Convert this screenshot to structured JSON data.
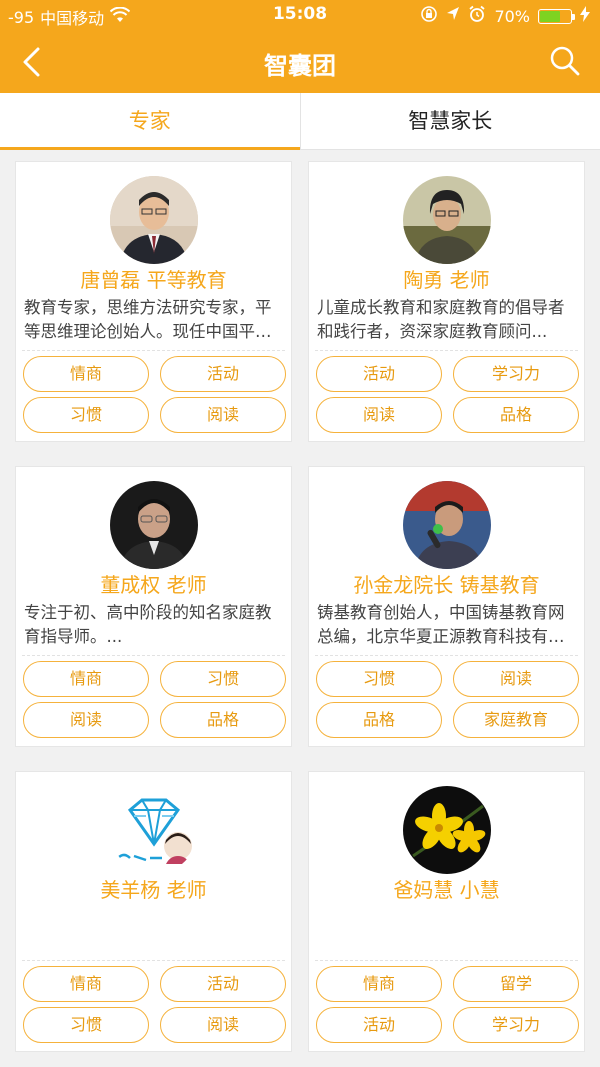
{
  "status_bar": {
    "signal": "-95",
    "carrier": "中国移动",
    "time": "15:08",
    "battery_text": "70%",
    "battery_level": 0.7,
    "icons": [
      "wifi-icon",
      "rotation-lock-icon",
      "location-icon",
      "alarm-icon",
      "battery-icon",
      "charging-icon"
    ]
  },
  "nav": {
    "title": "智囊团",
    "back_icon": "back-icon",
    "search_icon": "search-icon"
  },
  "tabs": [
    {
      "label": "专家",
      "active": true
    },
    {
      "label": "智慧家长",
      "active": false
    }
  ],
  "experts": [
    {
      "name": "唐曾磊 平等教育",
      "desc": "教育专家，思维方法研究专家，平等思维理论创始人。现任中国平等教育网总编...",
      "avatar": "man-in-suit-avatar",
      "tags": [
        "情商",
        "活动",
        "习惯",
        "阅读"
      ]
    },
    {
      "name": "陶勇 老师",
      "desc": "儿童成长教育和家庭教育的倡导者和践行者，资深家庭教育顾问...",
      "avatar": "man-outdoors-avatar",
      "tags": [
        "活动",
        "学习力",
        "阅读",
        "品格"
      ]
    },
    {
      "name": "董成权 老师",
      "desc": "专注于初、高中阶段的知名家庭教育指导师。...",
      "avatar": "man-glasses-avatar",
      "tags": [
        "情商",
        "习惯",
        "阅读",
        "品格"
      ]
    },
    {
      "name": "孙金龙院长 铸基教育",
      "desc": "铸基教育创始人，中国铸基教育网总编，北京华夏正源教育科技有限公司...",
      "avatar": "speaker-microphone-avatar",
      "tags": [
        "习惯",
        "阅读",
        "品格",
        "家庭教育"
      ]
    },
    {
      "name": "美羊杨 老师",
      "desc": "",
      "avatar": "diamond-logo-avatar",
      "tags": [
        "情商",
        "活动",
        "习惯",
        "阅读"
      ]
    },
    {
      "name": "爸妈慧 小慧",
      "desc": "",
      "avatar": "yellow-flower-avatar",
      "tags": [
        "情商",
        "留学",
        "活动",
        "学习力"
      ]
    }
  ],
  "colors": {
    "accent": "#f5a71c",
    "tag_border": "#f5b23c",
    "background": "#f1f1f1"
  }
}
